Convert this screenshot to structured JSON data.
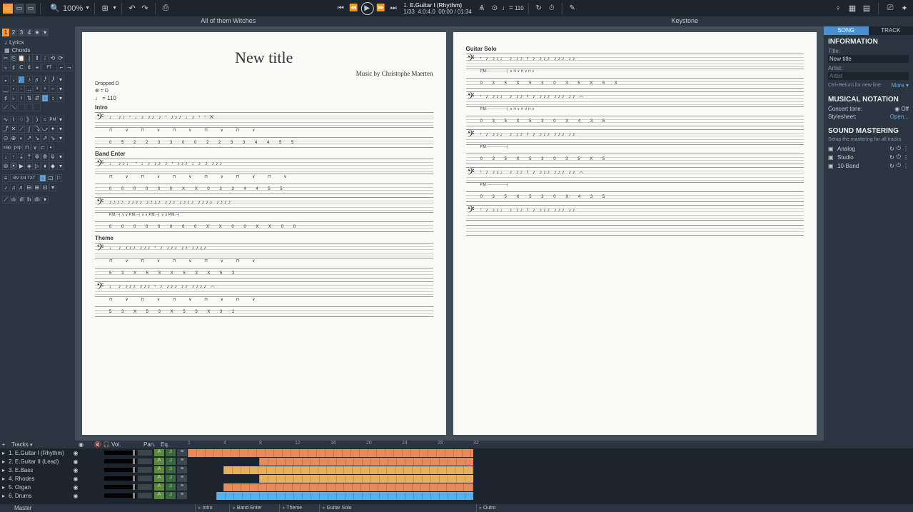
{
  "toolbar": {
    "zoom": "100%"
  },
  "transport": {
    "track_num": "1.",
    "track_name": "E.Guitar I (Rhythm)",
    "bar": "1/33",
    "timesig": "4.0:4.0",
    "time": "00:00 / 01:34",
    "tempo": "110"
  },
  "subheader": {
    "left": "All of them Witches",
    "right": "Keystone"
  },
  "leftpanel": {
    "tabs": [
      "1",
      "2",
      "3",
      "4"
    ],
    "lyrics": "Lyrics",
    "chords": "Chords",
    "signature": "BV 2/4 TXT"
  },
  "score": {
    "title": "New title",
    "credit": "Music by Christophe Maerten",
    "tuning": "Dropped D",
    "tuning2": "⊕ = D",
    "tempo": "♩ = 110",
    "sections": [
      "Intro",
      "Band Enter",
      "Theme"
    ],
    "page2_section": "Guitar Solo"
  },
  "rightpanel": {
    "tabs": [
      "SONG",
      "TRACK"
    ],
    "info_h": "INFORMATION",
    "title_label": "Title:",
    "title_value": "New title",
    "artist_label": "Artist:",
    "artist_placeholder": "Artist",
    "hint": "Ctrl+Return for new line.",
    "more": "More ▾",
    "notation_h": "MUSICAL NOTATION",
    "concert_tone": "Concert tone:",
    "concert_off": "Off",
    "stylesheet": "Stylesheet:",
    "open": "Open...",
    "mastering_h": "SOUND MASTERING",
    "mastering_sub": "Setup the mastering for all tracks",
    "chain": [
      "Analog",
      "Studio",
      "10-Band"
    ]
  },
  "tracks": {
    "header": "Tracks",
    "vol": "Vol.",
    "pan": "Pan.",
    "eq": "Eq.",
    "list": [
      {
        "n": "1.",
        "name": "E.Guitar I (Rhythm)"
      },
      {
        "n": "2.",
        "name": "E.Guitar II (Lead)"
      },
      {
        "n": "3.",
        "name": "E.Bass"
      },
      {
        "n": "4.",
        "name": "Rhodes"
      },
      {
        "n": "5.",
        "name": "Organ"
      },
      {
        "n": "6.",
        "name": "Drums"
      }
    ],
    "master": "Master"
  },
  "timeline": {
    "bars": [
      "1",
      "4",
      "8",
      "12",
      "16",
      "20",
      "24",
      "28",
      "32"
    ],
    "markers": [
      "Intro",
      "Band Enter",
      "Theme",
      "Guitar Solo",
      "Outro"
    ],
    "colors": [
      "#e88a5a",
      "#e88a5a",
      "#e8b05a",
      "#e8b05a",
      "#e88a5a",
      "#5ab0e8"
    ]
  }
}
